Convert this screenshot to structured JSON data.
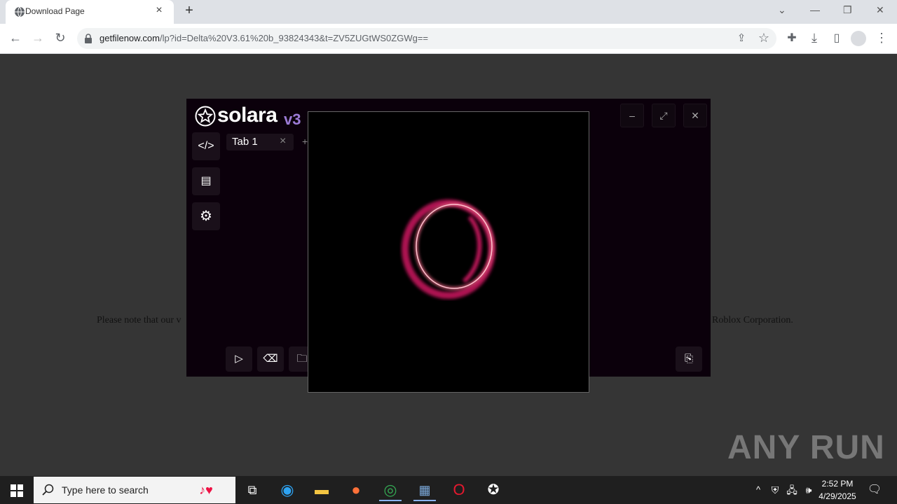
{
  "browser": {
    "tab_title": "Download Page",
    "tab_close": "×",
    "new_tab": "+",
    "url_host": "getfilenow.com",
    "url_path": "/lp?id=Delta%20V3.61%20b_93824343&t=ZV5ZUGtWS0ZGWg==",
    "window_controls": {
      "minimize": "—",
      "restore": "❐",
      "close": "✕",
      "tab_list": "⌄"
    }
  },
  "page": {
    "notice_left": "Please note that our v",
    "notice_right": "Roblox Corporation."
  },
  "app": {
    "logo_text": "solara",
    "logo_version": "v3",
    "tab_label": "Tab 1",
    "tab_close": "×",
    "tab_add": "+",
    "accent": "#c2185b"
  },
  "taskbar": {
    "search_placeholder": "Type here to search",
    "time": "2:52 PM",
    "date": "4/29/2025"
  },
  "watermark": "ANY RUN"
}
